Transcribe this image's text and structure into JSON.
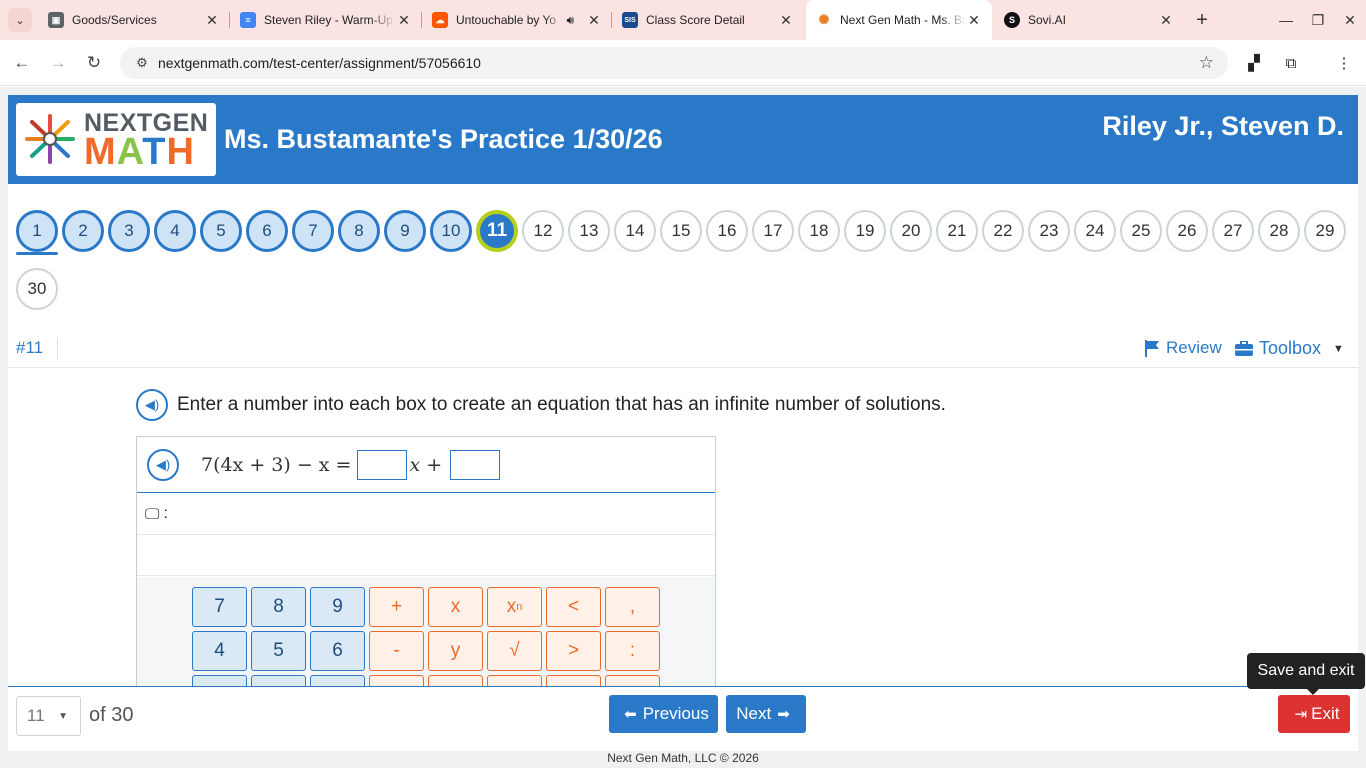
{
  "browser": {
    "tabs": [
      {
        "title": "Goods/Services",
        "favicon": "classroom-icon",
        "color": "#5f6368"
      },
      {
        "title": "Steven Riley - Warm-Up",
        "favicon": "docs-icon",
        "color": "#4285f4"
      },
      {
        "title": "Untouchable by Yo",
        "favicon": "soundcloud-icon",
        "color": "#ff5500"
      },
      {
        "title": "Class Score Detail",
        "favicon": "sis-icon",
        "color": "#1a4d8f"
      },
      {
        "title": "Next Gen Math - Ms. Bu",
        "favicon": "nextgen-icon",
        "color": "#ffffff"
      },
      {
        "title": "Sovi.AI",
        "favicon": "sovi-icon",
        "color": "#111111"
      }
    ],
    "active_tab": 4,
    "url": "nextgenmath.com/test-center/assignment/57056610"
  },
  "header": {
    "logo_top": "NEXTGEN",
    "logo_bottom": "MATH",
    "assignment_title": "Ms. Bustamante's Practice 1/30/26",
    "student_name": "Riley Jr., Steven D."
  },
  "question_nav": {
    "numbers": [
      "1",
      "2",
      "3",
      "4",
      "5",
      "6",
      "7",
      "8",
      "9",
      "10",
      "11",
      "12",
      "13",
      "14",
      "15",
      "16",
      "17",
      "18",
      "19",
      "20",
      "21",
      "22",
      "23",
      "24",
      "25",
      "26",
      "27",
      "28",
      "29",
      "30"
    ],
    "answered_through": 10,
    "current": 11
  },
  "question_bar": {
    "number_label": "#11",
    "review_label": "Review",
    "toolbox_label": "Toolbox"
  },
  "question": {
    "prompt": "Enter a number into each box to create an equation that has an infinite number of solutions.",
    "equation_left": "7(4x + 3) − x =",
    "equation_var": "x",
    "equation_plus": "+",
    "keyboard_label": ":"
  },
  "keypad": {
    "row1": [
      "7",
      "8",
      "9",
      "+",
      "x",
      "xn",
      "<",
      ","
    ],
    "row2": [
      "4",
      "5",
      "6",
      "-",
      "y",
      "√",
      ">",
      ":"
    ]
  },
  "footer": {
    "select_value": "11",
    "of_label": "of 30",
    "previous_label": "Previous",
    "next_label": "Next",
    "exit_label": "Exit",
    "tooltip": "Save and exit",
    "copyright": "Next Gen Math, LLC © 2026"
  },
  "colors": {
    "brand_blue": "#2a79c9",
    "current_ring": "#b6cf1a",
    "exit_red": "#dc3232",
    "operator_orange": "#ea6a2a"
  }
}
